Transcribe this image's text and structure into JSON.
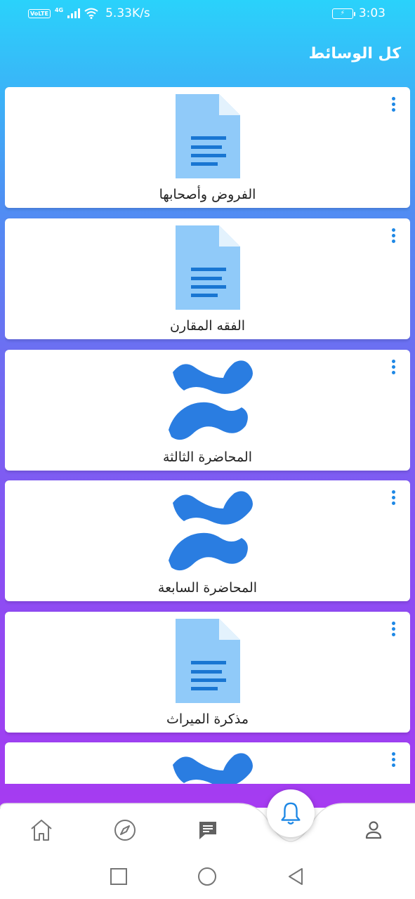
{
  "status_bar": {
    "volte": "VoLTE",
    "network": "4G",
    "speed": "5.33K/s",
    "time": "3:03"
  },
  "header": {
    "title": "كل الوسائط"
  },
  "media_items": [
    {
      "title": "الفروض وأصحابها",
      "icon": "document-icon"
    },
    {
      "title": "الفقه المقارن",
      "icon": "document-icon"
    },
    {
      "title": "المحاضرة الثالثة",
      "icon": "app-logo-icon"
    },
    {
      "title": "المحاضرة السابعة",
      "icon": "app-logo-icon"
    },
    {
      "title": "مذكرة الميراث",
      "icon": "document-icon"
    },
    {
      "title": "",
      "icon": "app-logo-icon"
    }
  ],
  "bottom_nav": {
    "items": [
      "home-icon",
      "explore-icon",
      "chat-icon",
      "notifications-icon",
      "profile-icon"
    ],
    "active": "notifications-icon"
  },
  "colors": {
    "gradient_top": "#2ad2fb",
    "gradient_bottom": "#a63bf1",
    "accent_blue": "#1e88e5",
    "doc_light": "#90caf9",
    "doc_lines": "#1976d2"
  }
}
